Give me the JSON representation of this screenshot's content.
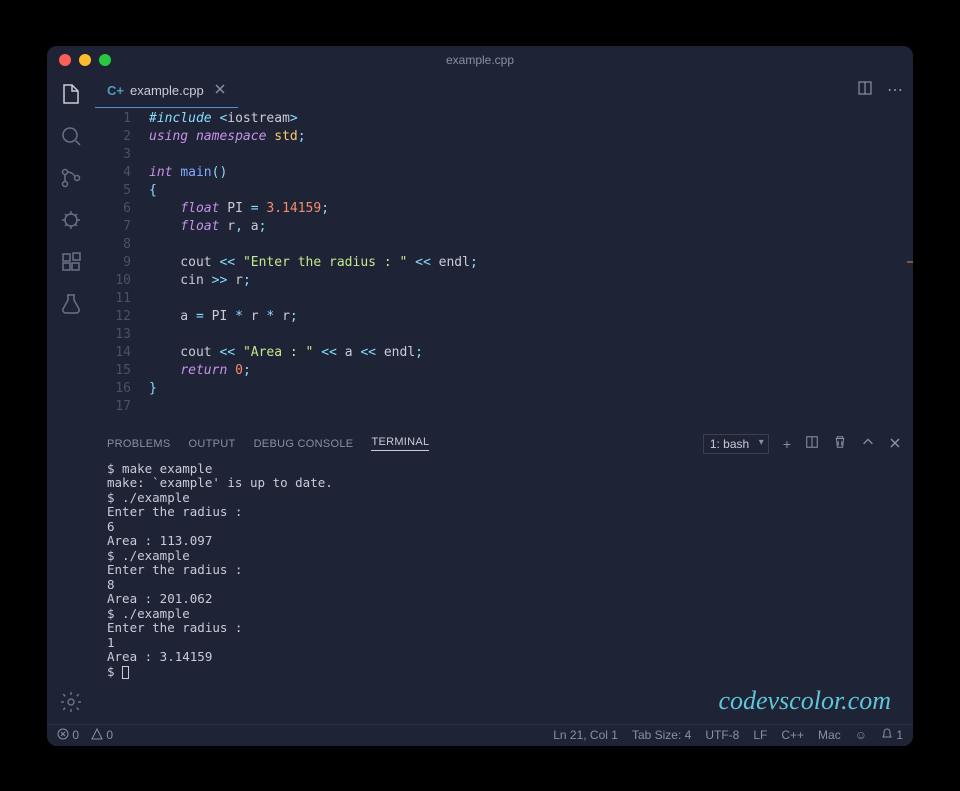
{
  "titlebar": {
    "title": "example.cpp"
  },
  "tab": {
    "filename": "example.cpp",
    "icon_label": "C+"
  },
  "code_lines": [
    {
      "n": "1",
      "html": "<span class='inc'>#include</span> <span class='op'>&lt;</span><span class='var'>iostream</span><span class='op'>&gt;</span>"
    },
    {
      "n": "2",
      "html": "<span class='kw'>using</span> <span class='kw'>namespace</span> <span class='ns'>std</span><span class='op'>;</span>"
    },
    {
      "n": "3",
      "html": ""
    },
    {
      "n": "4",
      "html": "<span class='type'>int</span> <span class='fn'>main</span><span class='op'>()</span>"
    },
    {
      "n": "5",
      "html": "<span class='op'>{</span>"
    },
    {
      "n": "6",
      "html": "    <span class='type'>float</span> PI <span class='op'>=</span> <span class='num'>3.14159</span><span class='op'>;</span>"
    },
    {
      "n": "7",
      "html": "    <span class='type'>float</span> r<span class='op'>,</span> a<span class='op'>;</span>"
    },
    {
      "n": "8",
      "html": ""
    },
    {
      "n": "9",
      "html": "    cout <span class='op'>&lt;&lt;</span> <span class='str'>\"Enter the radius : \"</span> <span class='op'>&lt;&lt;</span> endl<span class='op'>;</span>"
    },
    {
      "n": "10",
      "html": "    cin <span class='op'>&gt;&gt;</span> r<span class='op'>;</span>"
    },
    {
      "n": "11",
      "html": ""
    },
    {
      "n": "12",
      "html": "    a <span class='op'>=</span> PI <span class='op'>*</span> r <span class='op'>*</span> r<span class='op'>;</span>"
    },
    {
      "n": "13",
      "html": ""
    },
    {
      "n": "14",
      "html": "    cout <span class='op'>&lt;&lt;</span> <span class='str'>\"Area : \"</span> <span class='op'>&lt;&lt;</span> a <span class='op'>&lt;&lt;</span> endl<span class='op'>;</span>"
    },
    {
      "n": "15",
      "html": "    <span class='kw'>return</span> <span class='num'>0</span><span class='op'>;</span>"
    },
    {
      "n": "16",
      "html": "<span class='op'>}</span>"
    },
    {
      "n": "17",
      "html": ""
    }
  ],
  "panel": {
    "tabs": [
      "PROBLEMS",
      "OUTPUT",
      "DEBUG CONSOLE",
      "TERMINAL"
    ],
    "active_tab": "TERMINAL",
    "terminal_select": "1: bash"
  },
  "terminal_text": "$ make example\nmake: `example' is up to date.\n$ ./example\nEnter the radius :\n6\nArea : 113.097\n$ ./example\nEnter the radius :\n8\nArea : 201.062\n$ ./example\nEnter the radius :\n1\nArea : 3.14159\n$ ",
  "status": {
    "errors": "0",
    "warnings": "0",
    "ln_col": "Ln 21, Col 1",
    "tab_size": "Tab Size: 4",
    "encoding": "UTF-8",
    "eol": "LF",
    "lang": "C++",
    "os": "Mac",
    "bell": "1"
  },
  "watermark": "codevscolor.com"
}
